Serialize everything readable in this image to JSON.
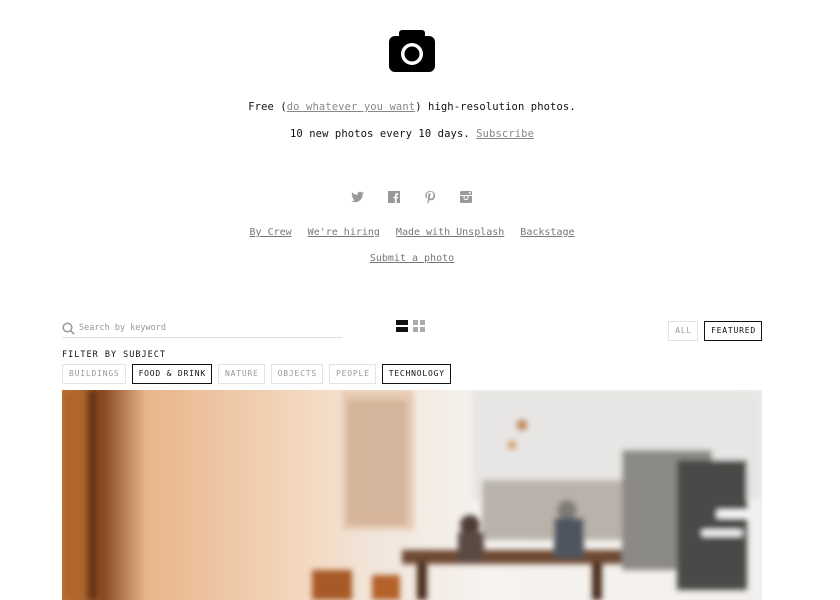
{
  "header": {
    "logo_icon": "camera-icon",
    "line1_prefix": "Free (",
    "line1_link": "do whatever you want",
    "line1_suffix": ") high-resolution photos.",
    "line2_text": "10 new photos every 10 days.",
    "line2_link": "Subscribe"
  },
  "social": [
    {
      "name": "twitter-icon"
    },
    {
      "name": "facebook-icon"
    },
    {
      "name": "pinterest-icon"
    },
    {
      "name": "instagram-icon"
    }
  ],
  "links": [
    "By Crew",
    "We're hiring",
    "Made with Unsplash",
    "Backstage"
  ],
  "submit_link": "Submit a photo",
  "search": {
    "placeholder": "Search by keyword"
  },
  "view_modes": [
    "list-view-icon",
    "grid-view-icon"
  ],
  "toggle": {
    "all": "ALL",
    "featured": "FEATURED"
  },
  "filter": {
    "label": "FILTER BY SUBJECT",
    "subjects": [
      "BUILDINGS",
      "FOOD & DRINK",
      "NATURE",
      "OBJECTS",
      "PEOPLE",
      "TECHNOLOGY"
    ]
  },
  "colors": {
    "link_gray": "#888888",
    "border_active": "#111111",
    "border_inactive": "#e3e3e3"
  }
}
